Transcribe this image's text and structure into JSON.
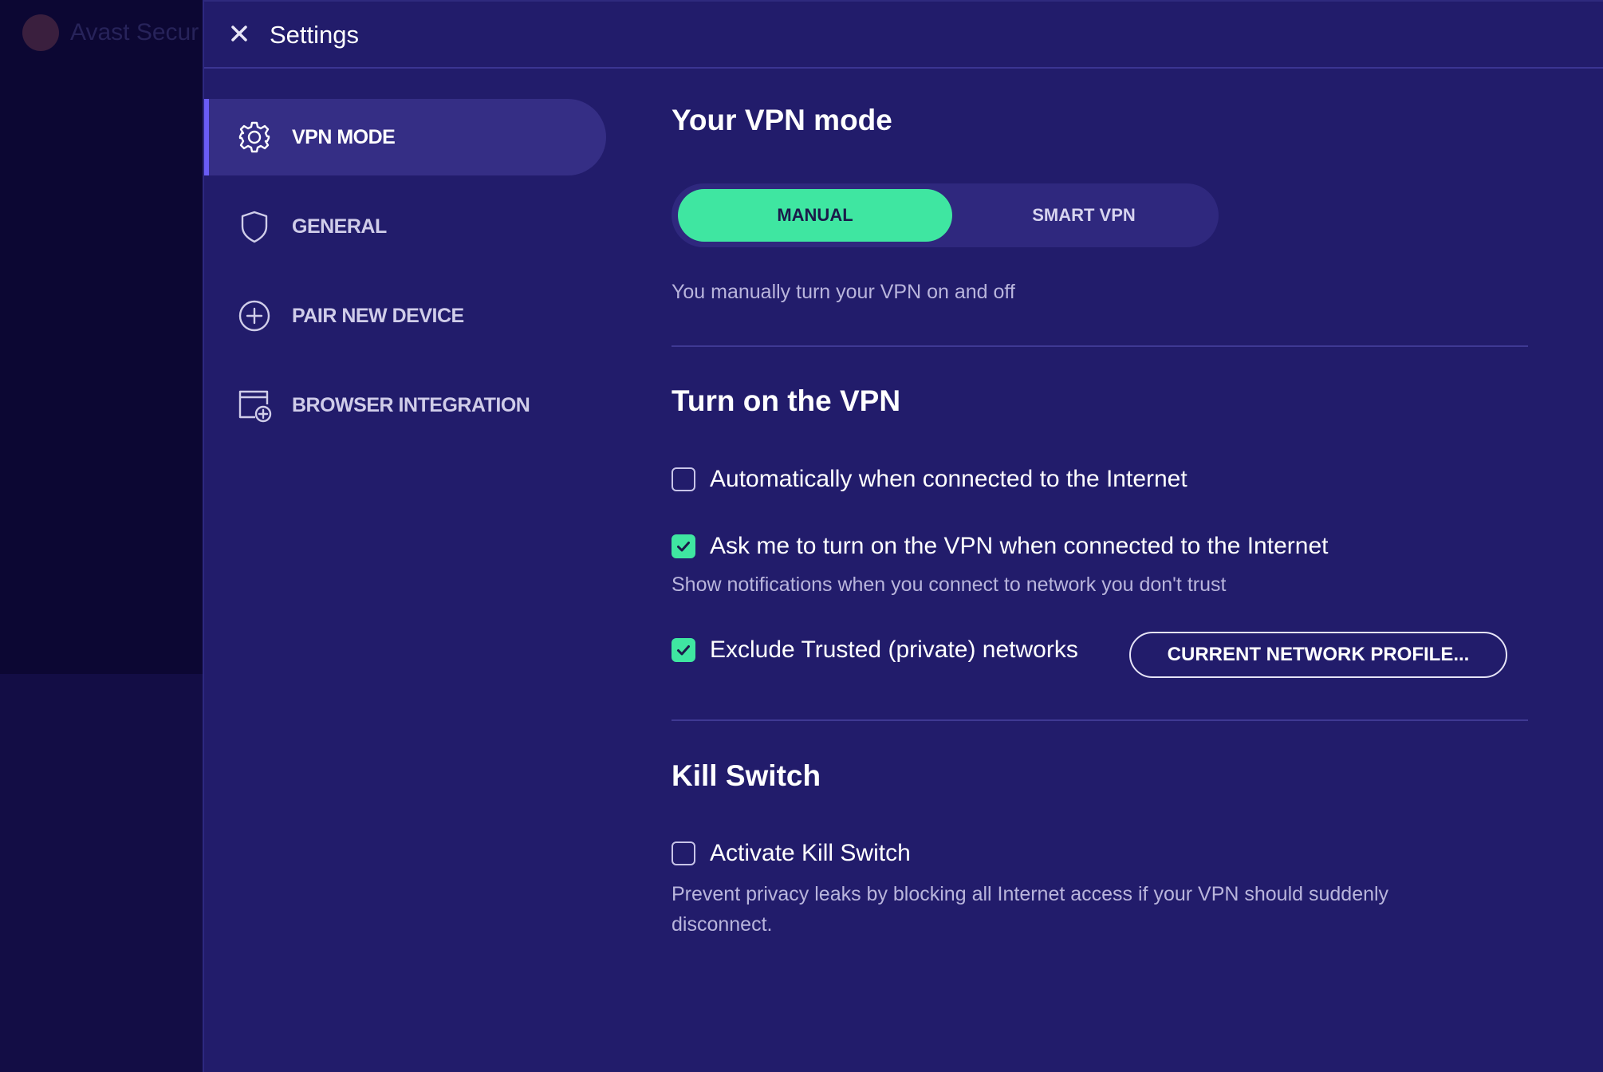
{
  "background_app": {
    "title": "Avast Secur"
  },
  "header": {
    "title": "Settings"
  },
  "sidebar": {
    "items": [
      {
        "label": "VPN MODE",
        "icon": "gear-icon",
        "active": true
      },
      {
        "label": "GENERAL",
        "icon": "shield-icon",
        "active": false
      },
      {
        "label": "PAIR NEW DEVICE",
        "icon": "plus-circle-icon",
        "active": false
      },
      {
        "label": "BROWSER INTEGRATION",
        "icon": "browser-add-icon",
        "active": false
      }
    ]
  },
  "vpn_mode": {
    "title": "Your VPN mode",
    "options": [
      "MANUAL",
      "SMART VPN"
    ],
    "selected": "MANUAL",
    "description": "You manually turn your VPN on and off"
  },
  "turn_on": {
    "title": "Turn on the VPN",
    "options": [
      {
        "label": "Automatically when connected to the Internet",
        "checked": false
      },
      {
        "label": "Ask me to turn on the VPN when connected to the Internet",
        "checked": true,
        "hint": "Show notifications when you connect to network you don't trust"
      },
      {
        "label": "Exclude Trusted (private) networks",
        "checked": true
      }
    ],
    "network_profile_button": "CURRENT NETWORK PROFILE..."
  },
  "kill_switch": {
    "title": "Kill Switch",
    "label": "Activate Kill Switch",
    "checked": false,
    "description": "Prevent privacy leaks by blocking all Internet access if your VPN should suddenly disconnect."
  },
  "colors": {
    "panel_bg": "#221c6b",
    "accent_green": "#3fe6a1",
    "accent_purple": "#6a5cf5"
  }
}
